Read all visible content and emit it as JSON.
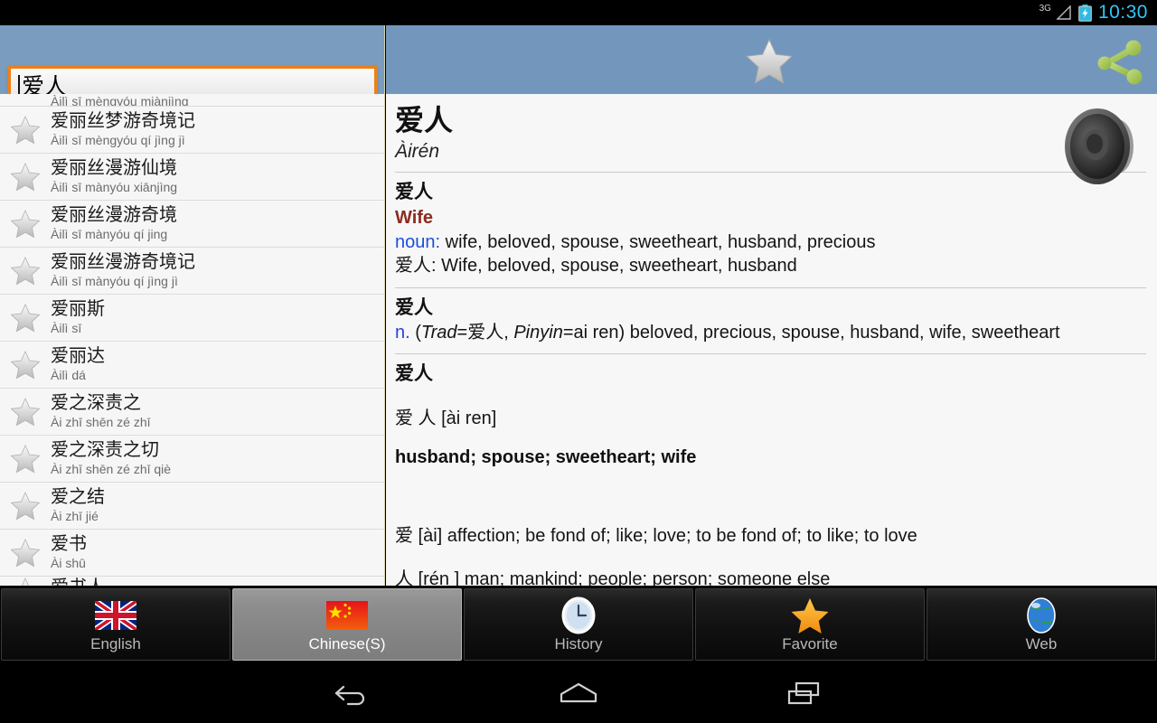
{
  "statusbar": {
    "network": "3G",
    "time": "10:30",
    "signal_icon": "signal-triangle-icon",
    "battery_icon": "battery-charging-icon"
  },
  "search": {
    "value": "爱人",
    "placeholder": ""
  },
  "actionbar": {
    "favorite_icon": "star-outline-icon",
    "share_icon": "share-icon"
  },
  "list": {
    "partial_top": {
      "pinyin": "Àilì sī mèngyóu miànjìng"
    },
    "items": [
      {
        "han": "爱丽丝梦游奇境记",
        "pinyin": "Àilì sī mèngyóu qí jìng jì"
      },
      {
        "han": "爱丽丝漫游仙境",
        "pinyin": "Àilì sī mànyóu xiānjìng"
      },
      {
        "han": "爱丽丝漫游奇境",
        "pinyin": "Àilì sī mànyóu qí jing"
      },
      {
        "han": "爱丽丝漫游奇境记",
        "pinyin": "Àilì sī mànyóu qí jìng jì"
      },
      {
        "han": "爱丽斯",
        "pinyin": "Àilì sī"
      },
      {
        "han": "爱丽达",
        "pinyin": "Àilì dá"
      },
      {
        "han": "爱之深责之",
        "pinyin": "Ài zhī shēn zé zhī"
      },
      {
        "han": "爱之深责之切",
        "pinyin": "Ài zhī shēn zé zhī qiè"
      },
      {
        "han": "爱之结",
        "pinyin": "Ài zhī jié"
      },
      {
        "han": "爱书",
        "pinyin": "Ài shū"
      }
    ],
    "partial_bottom": {
      "han": "爱书人"
    }
  },
  "detail": {
    "headword": "爱人",
    "headword_pinyin": "Àirén",
    "speaker_icon": "speaker-icon",
    "block1": {
      "han": "爱人",
      "title": "Wife",
      "pos": "noun:",
      "definitions": " wife, beloved, spouse, sweetheart, husband, precious",
      "second_line_han": "爱人",
      "second_line_defs": ": Wife, beloved, spouse, sweetheart, husband"
    },
    "block2": {
      "han": "爱人",
      "pos": "n.",
      "paren_open": " (",
      "trad_label": "Trad",
      "trad_value": "=爱人, ",
      "pinyin_label": "Pinyin",
      "pinyin_value": "=ai ren)",
      "definitions": " beloved, precious, spouse, husband, wife, sweetheart"
    },
    "block3": {
      "han": "爱人",
      "pronunciation": "爱 人 [ài ren]",
      "meanings": "husband; spouse; sweetheart; wife",
      "char1": "爱 [ài] affection; be fond of; like; love; to be fond of; to like; to love",
      "char2": "人 [rén ] man; mankind; people; person; someone else"
    }
  },
  "tabs": [
    {
      "label": "English",
      "icon": "uk-flag-icon",
      "selected": false
    },
    {
      "label": "Chinese(S)",
      "icon": "china-flag-icon",
      "selected": true
    },
    {
      "label": "History",
      "icon": "clock-icon",
      "selected": false
    },
    {
      "label": "Favorite",
      "icon": "star-filled-icon",
      "selected": false
    },
    {
      "label": "Web",
      "icon": "globe-icon",
      "selected": false
    }
  ],
  "navbar": {
    "back": "back-icon",
    "home": "home-icon",
    "recents": "recents-icon"
  },
  "colors": {
    "actionbar_blue": "#7397bc",
    "search_border_orange": "#eb8019",
    "title_red": "#8d2b20",
    "pos_blue": "#1a4fe0",
    "clock_blue": "#35c6f4"
  }
}
